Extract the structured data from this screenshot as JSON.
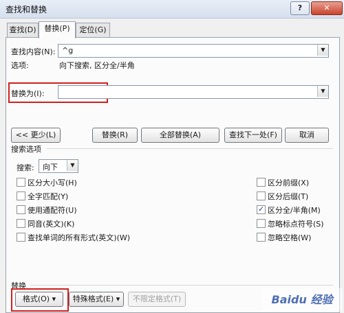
{
  "window": {
    "title": "查找和替换",
    "help_label": "?",
    "close_label": "✕"
  },
  "tabs": [
    {
      "label": "查找(D)"
    },
    {
      "label": "替换(P)"
    },
    {
      "label": "定位(G)"
    }
  ],
  "find": {
    "label": "查找内容(N):",
    "value": "^g",
    "options_label": "选项:",
    "options_value": "向下搜索, 区分全/半角"
  },
  "replace": {
    "label": "替换为(I):",
    "value": ""
  },
  "buttons": {
    "less": "<< 更少(L)",
    "replace": "替换(R)",
    "replace_all": "全部替换(A)",
    "find_next": "查找下一处(F)",
    "cancel": "取消"
  },
  "search_options": {
    "group_label": "搜索选项",
    "search_label": "搜索:",
    "search_value": "向下"
  },
  "left_checks": [
    {
      "label": "区分大小写(H)",
      "checked": false
    },
    {
      "label": "全字匹配(Y)",
      "checked": false
    },
    {
      "label": "使用通配符(U)",
      "checked": false
    },
    {
      "label": "同音(英文)(K)",
      "checked": false
    },
    {
      "label": "查找单词的所有形式(英文)(W)",
      "checked": false
    }
  ],
  "right_checks": [
    {
      "label": "区分前缀(X)",
      "checked": false
    },
    {
      "label": "区分后缀(T)",
      "checked": false
    },
    {
      "label": "区分全/半角(M)",
      "checked": true
    },
    {
      "label": "忽略标点符号(S)",
      "checked": false
    },
    {
      "label": "忽略空格(W)",
      "checked": false
    }
  ],
  "replace_group": {
    "label": "替换",
    "format": "格式(O) ▾",
    "special": "特殊格式(E) ▾",
    "no_format": "不限定格式(T)"
  },
  "watermark": "Baidu 经验"
}
